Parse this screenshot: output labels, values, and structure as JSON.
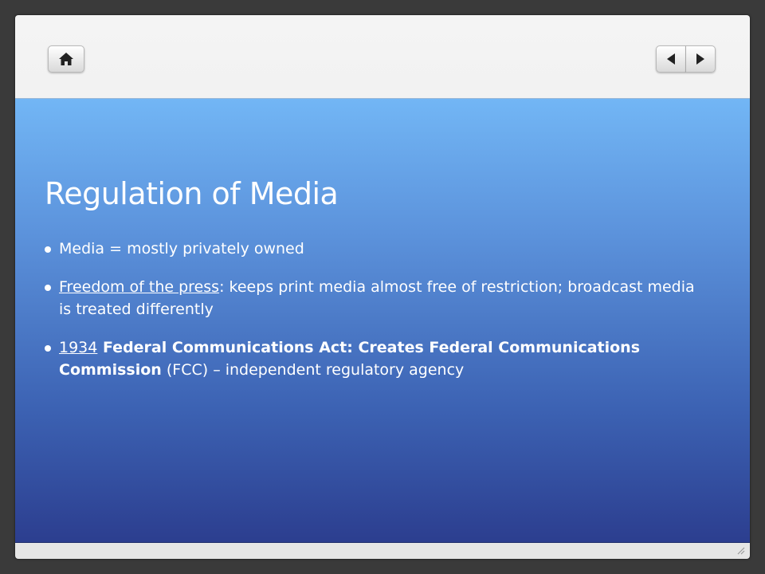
{
  "slide": {
    "title": "Regulation of Media",
    "bullets": [
      {
        "text": "Media = mostly privately owned"
      },
      {
        "underlined": "Freedom of the press",
        "text": ": keeps print media almost free of restriction; broadcast media is treated differently"
      },
      {
        "underlined": "1934",
        "bold": " Federal Communications Act: Creates Federal Communications Commission",
        "text": " (FCC) – independent regulatory agency"
      }
    ]
  },
  "nav": {
    "home_icon": "home-icon",
    "prev_icon": "triangle-left-icon",
    "next_icon": "triangle-right-icon"
  },
  "colors": {
    "slide_top": "#72b6f5",
    "slide_bottom": "#2c3e8f",
    "frame": "#efefef",
    "text": "#ffffff"
  }
}
